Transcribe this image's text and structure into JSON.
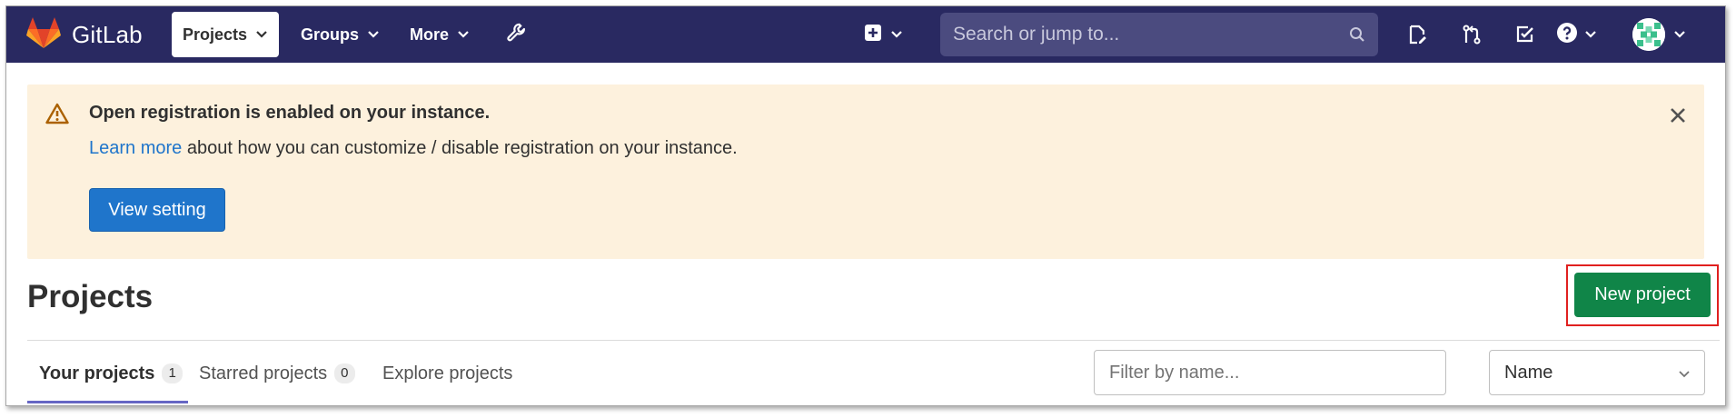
{
  "colors": {
    "navbar_bg": "#292961",
    "search_bg": "#4b4b7f",
    "alert_bg": "#fdf1dd",
    "link": "#1f75cb",
    "primary_button": "#1f75cb",
    "success_button": "#108548",
    "highlight_box": "#e0201f",
    "tab_underline": "#6666c4"
  },
  "navbar": {
    "brand": "GitLab",
    "logo_icon": "gitlab-tanuki-icon",
    "menu": [
      {
        "label": "Projects",
        "active": true,
        "icon": "chevron-down-icon"
      },
      {
        "label": "Groups",
        "active": false,
        "icon": "chevron-down-icon"
      },
      {
        "label": "More",
        "active": false,
        "icon": "chevron-down-icon"
      }
    ],
    "admin_icon": "wrench-icon",
    "new_icon": "plus-square-icon",
    "search": {
      "placeholder": "Search or jump to...",
      "icon": "search-icon"
    },
    "right_icons": [
      "issues-icon",
      "merge-request-icon",
      "todo-icon",
      "help-icon",
      "avatar"
    ]
  },
  "alert": {
    "icon": "warning-icon",
    "title": "Open registration is enabled on your instance.",
    "link_text": "Learn more",
    "body_text": " about how you can customize / disable registration on your instance.",
    "button_label": "View setting",
    "close_icon": "close-icon"
  },
  "page": {
    "title": "Projects",
    "new_project_label": "New project"
  },
  "tabs": [
    {
      "label": "Your projects",
      "count": "1",
      "active": true
    },
    {
      "label": "Starred projects",
      "count": "0",
      "active": false
    },
    {
      "label": "Explore projects",
      "count": "",
      "active": false
    }
  ],
  "filter": {
    "placeholder": "Filter by name..."
  },
  "sort": {
    "selected": "Name",
    "icon": "chevron-down-icon"
  }
}
